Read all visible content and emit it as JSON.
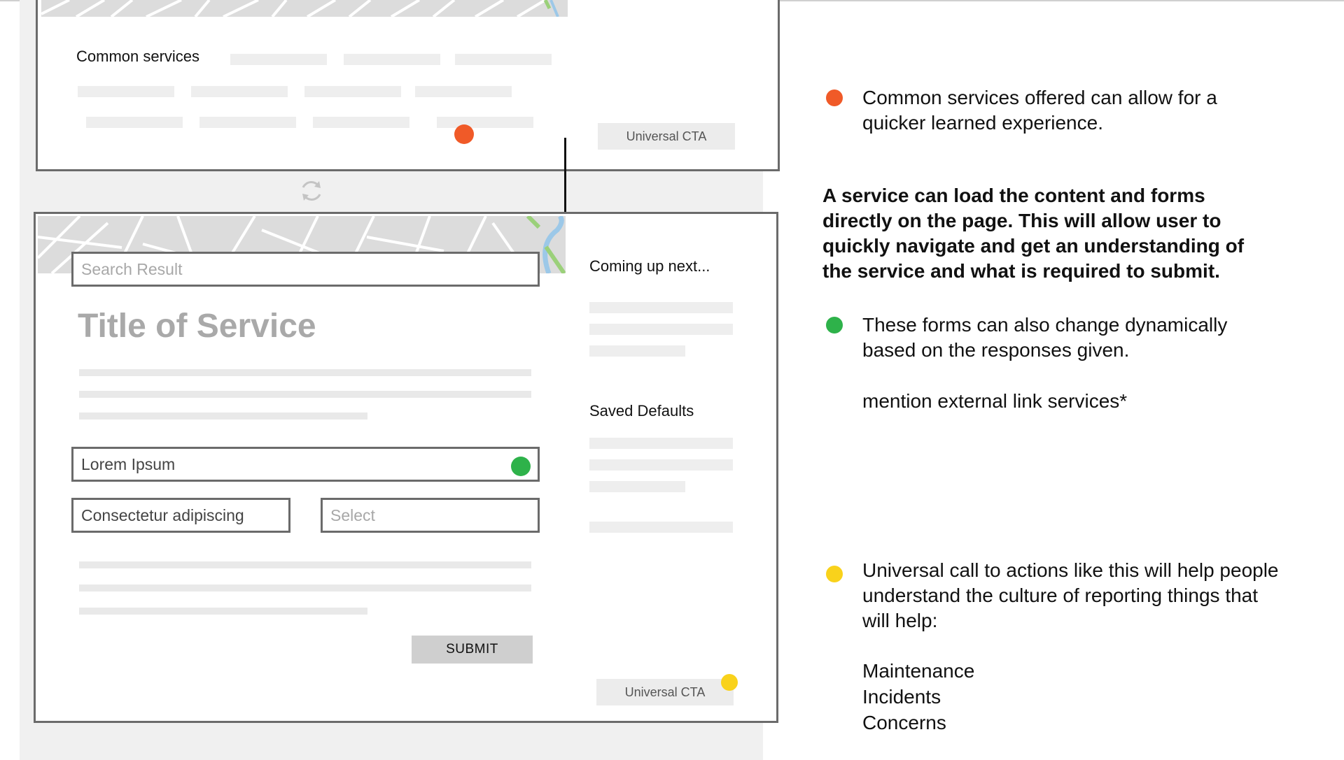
{
  "wireframe_top": {
    "section_label": "Common services",
    "cta_label": "Universal CTA"
  },
  "wireframe_main": {
    "search_placeholder": "Search Result",
    "service_title": "Title of Service",
    "field_lorem": "Lorem Ipsum",
    "field_consectetur": "Consectetur adipiscing",
    "select_placeholder": "Select",
    "submit_label": "SUBMIT",
    "cta_label": "Universal CTA",
    "sidebar_next": "Coming up next...",
    "sidebar_defaults": "Saved Defaults"
  },
  "annotations": {
    "orange_note": [
      "Common services offered can allow for a",
      "quicker learned experience."
    ],
    "bold_note": [
      "A service can load the content and forms",
      "directly on the page. This will allow user to",
      "quickly navigate and get an understanding of",
      "the service and what is required to submit."
    ],
    "green_note": [
      "These forms can also change dynamically",
      "based on the responses given."
    ],
    "external_note": "mention external link services*",
    "yellow_note": [
      "Universal call to actions like this will help people",
      "understand the culture of reporting things that",
      "will help:"
    ],
    "yellow_list": [
      "Maintenance",
      "Incidents",
      "Concerns"
    ]
  },
  "colors": {
    "orange": "#f05a28",
    "green": "#2eb24a",
    "yellow": "#f9d21b",
    "frame_border": "#6b6b6b"
  },
  "icons": {
    "refresh": "refresh-icon",
    "arrow": "arrow-down-icon"
  }
}
